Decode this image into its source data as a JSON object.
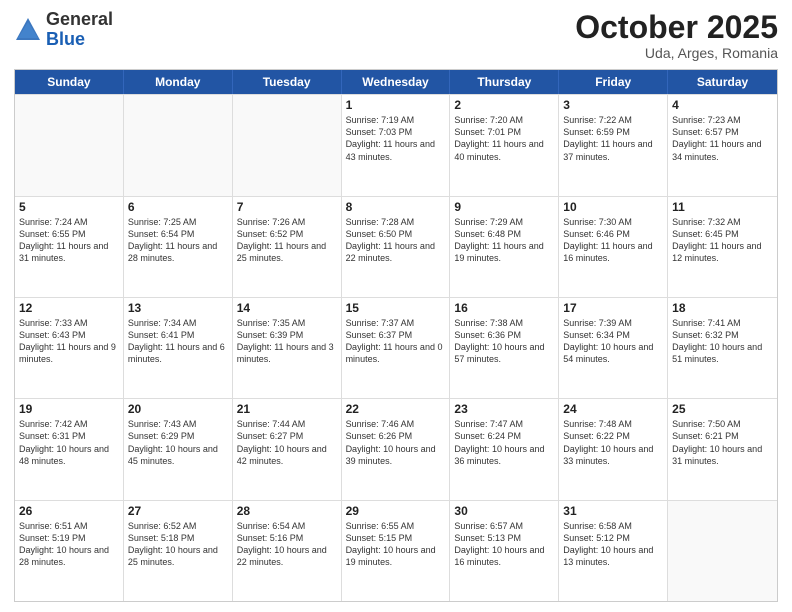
{
  "header": {
    "logo_general": "General",
    "logo_blue": "Blue",
    "title": "October 2025",
    "subtitle": "Uda, Arges, Romania"
  },
  "calendar": {
    "days_of_week": [
      "Sunday",
      "Monday",
      "Tuesday",
      "Wednesday",
      "Thursday",
      "Friday",
      "Saturday"
    ],
    "weeks": [
      [
        {
          "day": "",
          "info": "",
          "empty": true
        },
        {
          "day": "",
          "info": "",
          "empty": true
        },
        {
          "day": "",
          "info": "",
          "empty": true
        },
        {
          "day": "1",
          "info": "Sunrise: 7:19 AM\nSunset: 7:03 PM\nDaylight: 11 hours and 43 minutes.",
          "empty": false
        },
        {
          "day": "2",
          "info": "Sunrise: 7:20 AM\nSunset: 7:01 PM\nDaylight: 11 hours and 40 minutes.",
          "empty": false
        },
        {
          "day": "3",
          "info": "Sunrise: 7:22 AM\nSunset: 6:59 PM\nDaylight: 11 hours and 37 minutes.",
          "empty": false
        },
        {
          "day": "4",
          "info": "Sunrise: 7:23 AM\nSunset: 6:57 PM\nDaylight: 11 hours and 34 minutes.",
          "empty": false
        }
      ],
      [
        {
          "day": "5",
          "info": "Sunrise: 7:24 AM\nSunset: 6:55 PM\nDaylight: 11 hours and 31 minutes.",
          "empty": false
        },
        {
          "day": "6",
          "info": "Sunrise: 7:25 AM\nSunset: 6:54 PM\nDaylight: 11 hours and 28 minutes.",
          "empty": false
        },
        {
          "day": "7",
          "info": "Sunrise: 7:26 AM\nSunset: 6:52 PM\nDaylight: 11 hours and 25 minutes.",
          "empty": false
        },
        {
          "day": "8",
          "info": "Sunrise: 7:28 AM\nSunset: 6:50 PM\nDaylight: 11 hours and 22 minutes.",
          "empty": false
        },
        {
          "day": "9",
          "info": "Sunrise: 7:29 AM\nSunset: 6:48 PM\nDaylight: 11 hours and 19 minutes.",
          "empty": false
        },
        {
          "day": "10",
          "info": "Sunrise: 7:30 AM\nSunset: 6:46 PM\nDaylight: 11 hours and 16 minutes.",
          "empty": false
        },
        {
          "day": "11",
          "info": "Sunrise: 7:32 AM\nSunset: 6:45 PM\nDaylight: 11 hours and 12 minutes.",
          "empty": false
        }
      ],
      [
        {
          "day": "12",
          "info": "Sunrise: 7:33 AM\nSunset: 6:43 PM\nDaylight: 11 hours and 9 minutes.",
          "empty": false
        },
        {
          "day": "13",
          "info": "Sunrise: 7:34 AM\nSunset: 6:41 PM\nDaylight: 11 hours and 6 minutes.",
          "empty": false
        },
        {
          "day": "14",
          "info": "Sunrise: 7:35 AM\nSunset: 6:39 PM\nDaylight: 11 hours and 3 minutes.",
          "empty": false
        },
        {
          "day": "15",
          "info": "Sunrise: 7:37 AM\nSunset: 6:37 PM\nDaylight: 11 hours and 0 minutes.",
          "empty": false
        },
        {
          "day": "16",
          "info": "Sunrise: 7:38 AM\nSunset: 6:36 PM\nDaylight: 10 hours and 57 minutes.",
          "empty": false
        },
        {
          "day": "17",
          "info": "Sunrise: 7:39 AM\nSunset: 6:34 PM\nDaylight: 10 hours and 54 minutes.",
          "empty": false
        },
        {
          "day": "18",
          "info": "Sunrise: 7:41 AM\nSunset: 6:32 PM\nDaylight: 10 hours and 51 minutes.",
          "empty": false
        }
      ],
      [
        {
          "day": "19",
          "info": "Sunrise: 7:42 AM\nSunset: 6:31 PM\nDaylight: 10 hours and 48 minutes.",
          "empty": false
        },
        {
          "day": "20",
          "info": "Sunrise: 7:43 AM\nSunset: 6:29 PM\nDaylight: 10 hours and 45 minutes.",
          "empty": false
        },
        {
          "day": "21",
          "info": "Sunrise: 7:44 AM\nSunset: 6:27 PM\nDaylight: 10 hours and 42 minutes.",
          "empty": false
        },
        {
          "day": "22",
          "info": "Sunrise: 7:46 AM\nSunset: 6:26 PM\nDaylight: 10 hours and 39 minutes.",
          "empty": false
        },
        {
          "day": "23",
          "info": "Sunrise: 7:47 AM\nSunset: 6:24 PM\nDaylight: 10 hours and 36 minutes.",
          "empty": false
        },
        {
          "day": "24",
          "info": "Sunrise: 7:48 AM\nSunset: 6:22 PM\nDaylight: 10 hours and 33 minutes.",
          "empty": false
        },
        {
          "day": "25",
          "info": "Sunrise: 7:50 AM\nSunset: 6:21 PM\nDaylight: 10 hours and 31 minutes.",
          "empty": false
        }
      ],
      [
        {
          "day": "26",
          "info": "Sunrise: 6:51 AM\nSunset: 5:19 PM\nDaylight: 10 hours and 28 minutes.",
          "empty": false
        },
        {
          "day": "27",
          "info": "Sunrise: 6:52 AM\nSunset: 5:18 PM\nDaylight: 10 hours and 25 minutes.",
          "empty": false
        },
        {
          "day": "28",
          "info": "Sunrise: 6:54 AM\nSunset: 5:16 PM\nDaylight: 10 hours and 22 minutes.",
          "empty": false
        },
        {
          "day": "29",
          "info": "Sunrise: 6:55 AM\nSunset: 5:15 PM\nDaylight: 10 hours and 19 minutes.",
          "empty": false
        },
        {
          "day": "30",
          "info": "Sunrise: 6:57 AM\nSunset: 5:13 PM\nDaylight: 10 hours and 16 minutes.",
          "empty": false
        },
        {
          "day": "31",
          "info": "Sunrise: 6:58 AM\nSunset: 5:12 PM\nDaylight: 10 hours and 13 minutes.",
          "empty": false
        },
        {
          "day": "",
          "info": "",
          "empty": true
        }
      ]
    ]
  }
}
